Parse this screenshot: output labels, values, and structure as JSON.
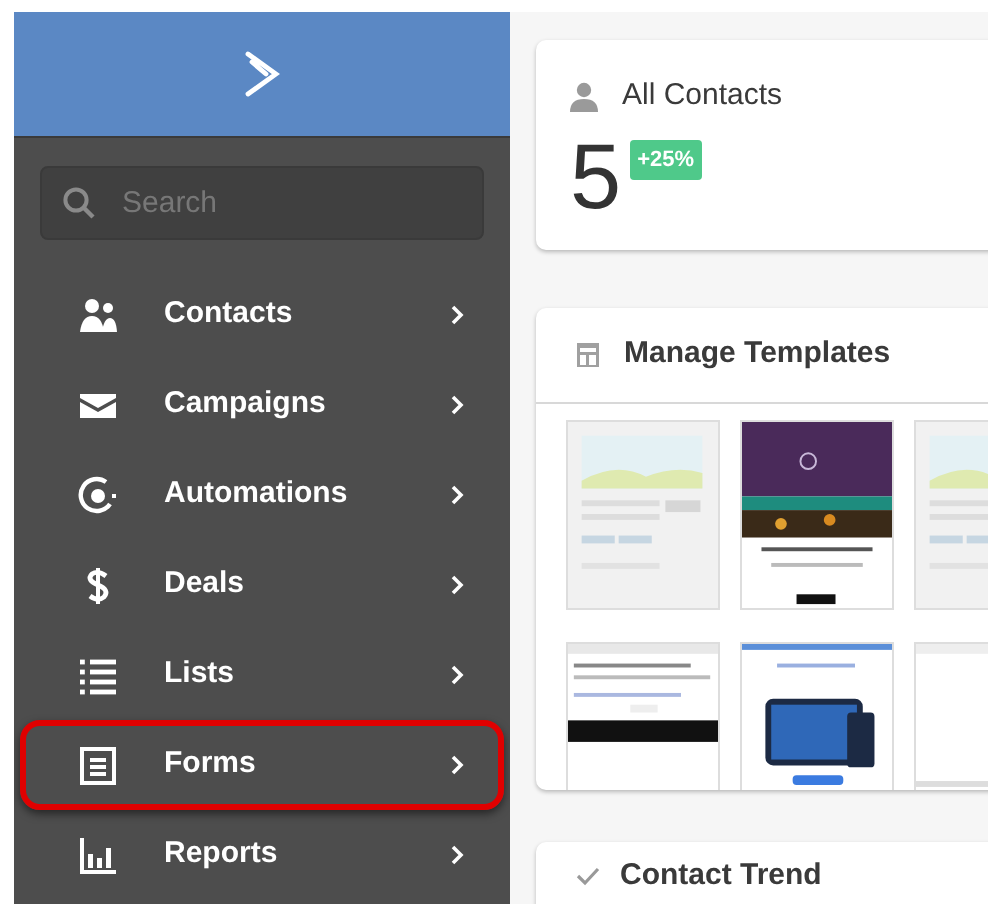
{
  "sidebar": {
    "search": {
      "placeholder": "Search"
    },
    "items": [
      {
        "label": "Contacts",
        "highlighted": false
      },
      {
        "label": "Campaigns",
        "highlighted": false
      },
      {
        "label": "Automations",
        "highlighted": false
      },
      {
        "label": "Deals",
        "highlighted": false
      },
      {
        "label": "Lists",
        "highlighted": false
      },
      {
        "label": "Forms",
        "highlighted": true
      },
      {
        "label": "Reports",
        "highlighted": false
      }
    ]
  },
  "contacts_card": {
    "title": "All Contacts",
    "count": "5",
    "badge": "+25%"
  },
  "templates_card": {
    "title": "Manage Templates"
  },
  "trend_card": {
    "title": "Contact Trend"
  }
}
